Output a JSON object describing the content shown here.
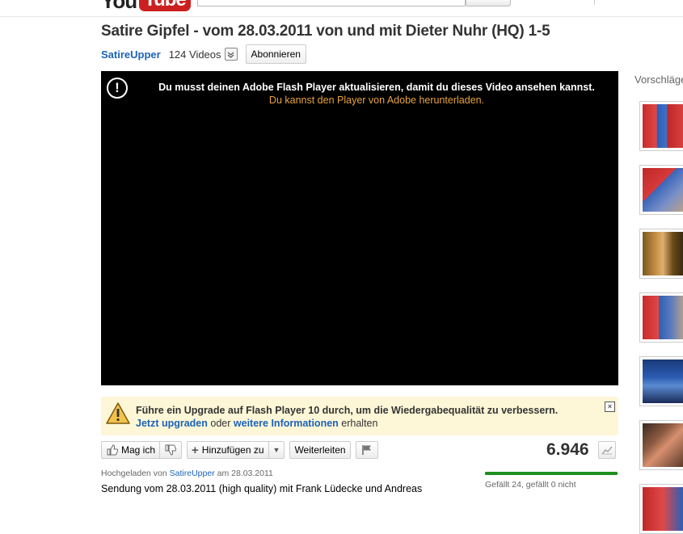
{
  "header": {
    "logo_you": "You",
    "logo_tube": "Tube"
  },
  "video": {
    "title": "Satire Gipfel - vom 28.03.2011 von und mit Dieter Nuhr (HQ) 1-5",
    "channel_name": "SatireUpper",
    "video_count": "124 Videos",
    "subscribe_label": "Abonnieren"
  },
  "player": {
    "message_line1": "Du musst deinen Adobe Flash Player aktualisieren, damit du dieses Video ansehen kannst.",
    "message_line2": "Du kannst den Player von Adobe herunterladen."
  },
  "upgrade_notice": {
    "line1": "Führe ein Upgrade auf Flash Player 10 durch, um die Wiedergabequalität zu verbessern.",
    "upgrade_link": "Jetzt upgraden",
    "middle_text": "oder",
    "info_link": "weitere Informationen",
    "end_text": "erhalten"
  },
  "actions": {
    "like_label": "Mag ich",
    "add_label": "Hinzufügen zu",
    "share_label": "Weiterleiten",
    "view_count": "6.946"
  },
  "meta": {
    "uploaded_prefix": "Hochgeladen von",
    "uploader": "SatireUpper",
    "uploaded_suffix": "am 28.03.2011",
    "rating_text": "Gefällt 24, gefällt 0 nicht",
    "likes_ratio": 1.0,
    "description": "Sendung vom 28.03.2011 (high quality) mit Frank Lüdecke und Andreas"
  },
  "sidebar": {
    "title": "Vorschläge"
  },
  "colors": {
    "link_blue": "#1c62b9",
    "youtube_red": "#cc1f1f",
    "notice_bg": "#fdf7d7",
    "player_link": "#e8a33d",
    "rating_green": "#1f8f1f"
  }
}
